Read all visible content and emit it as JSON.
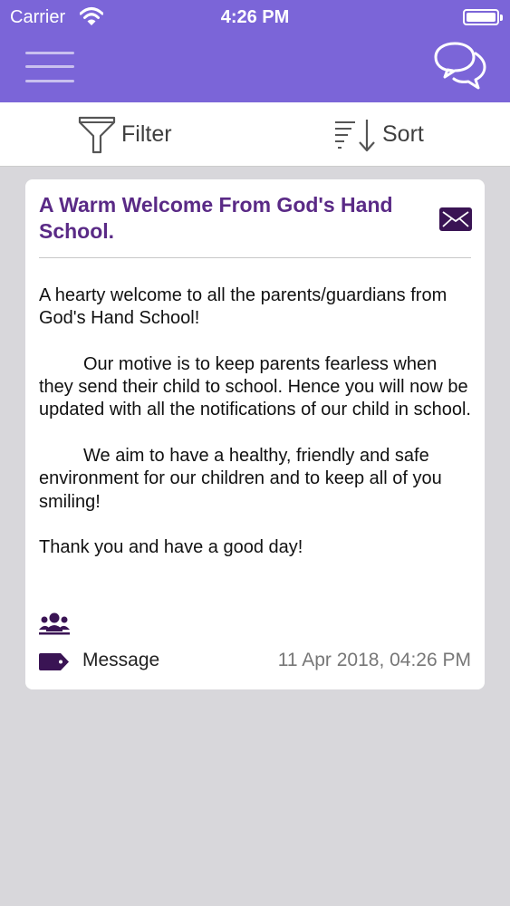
{
  "status_bar": {
    "carrier": "Carrier",
    "time": "4:26 PM"
  },
  "header": {
    "menu_icon": "hamburger-menu-icon",
    "chat_icon": "chat-bubbles-icon",
    "background_color": "#7b65d8"
  },
  "toolbar": {
    "filter_label": "Filter",
    "sort_label": "Sort"
  },
  "notice": {
    "title": "A Warm Welcome From God's Hand School.",
    "paragraphs": [
      "A hearty welcome to all the parents/guardians from God's Hand School!",
      "Our motive is to keep parents fearless when they send their child to school. Hence you will now be updated with all the notifications of our child in school.",
      "We aim to have a healthy, friendly and safe environment for our children and to keep all of you smiling!",
      "Thank you and have a good day!"
    ],
    "tag": "Message",
    "timestamp": "11 Apr 2018, 04:26 PM",
    "title_color": "#5a2a86",
    "icon_color": "#3a1454"
  }
}
